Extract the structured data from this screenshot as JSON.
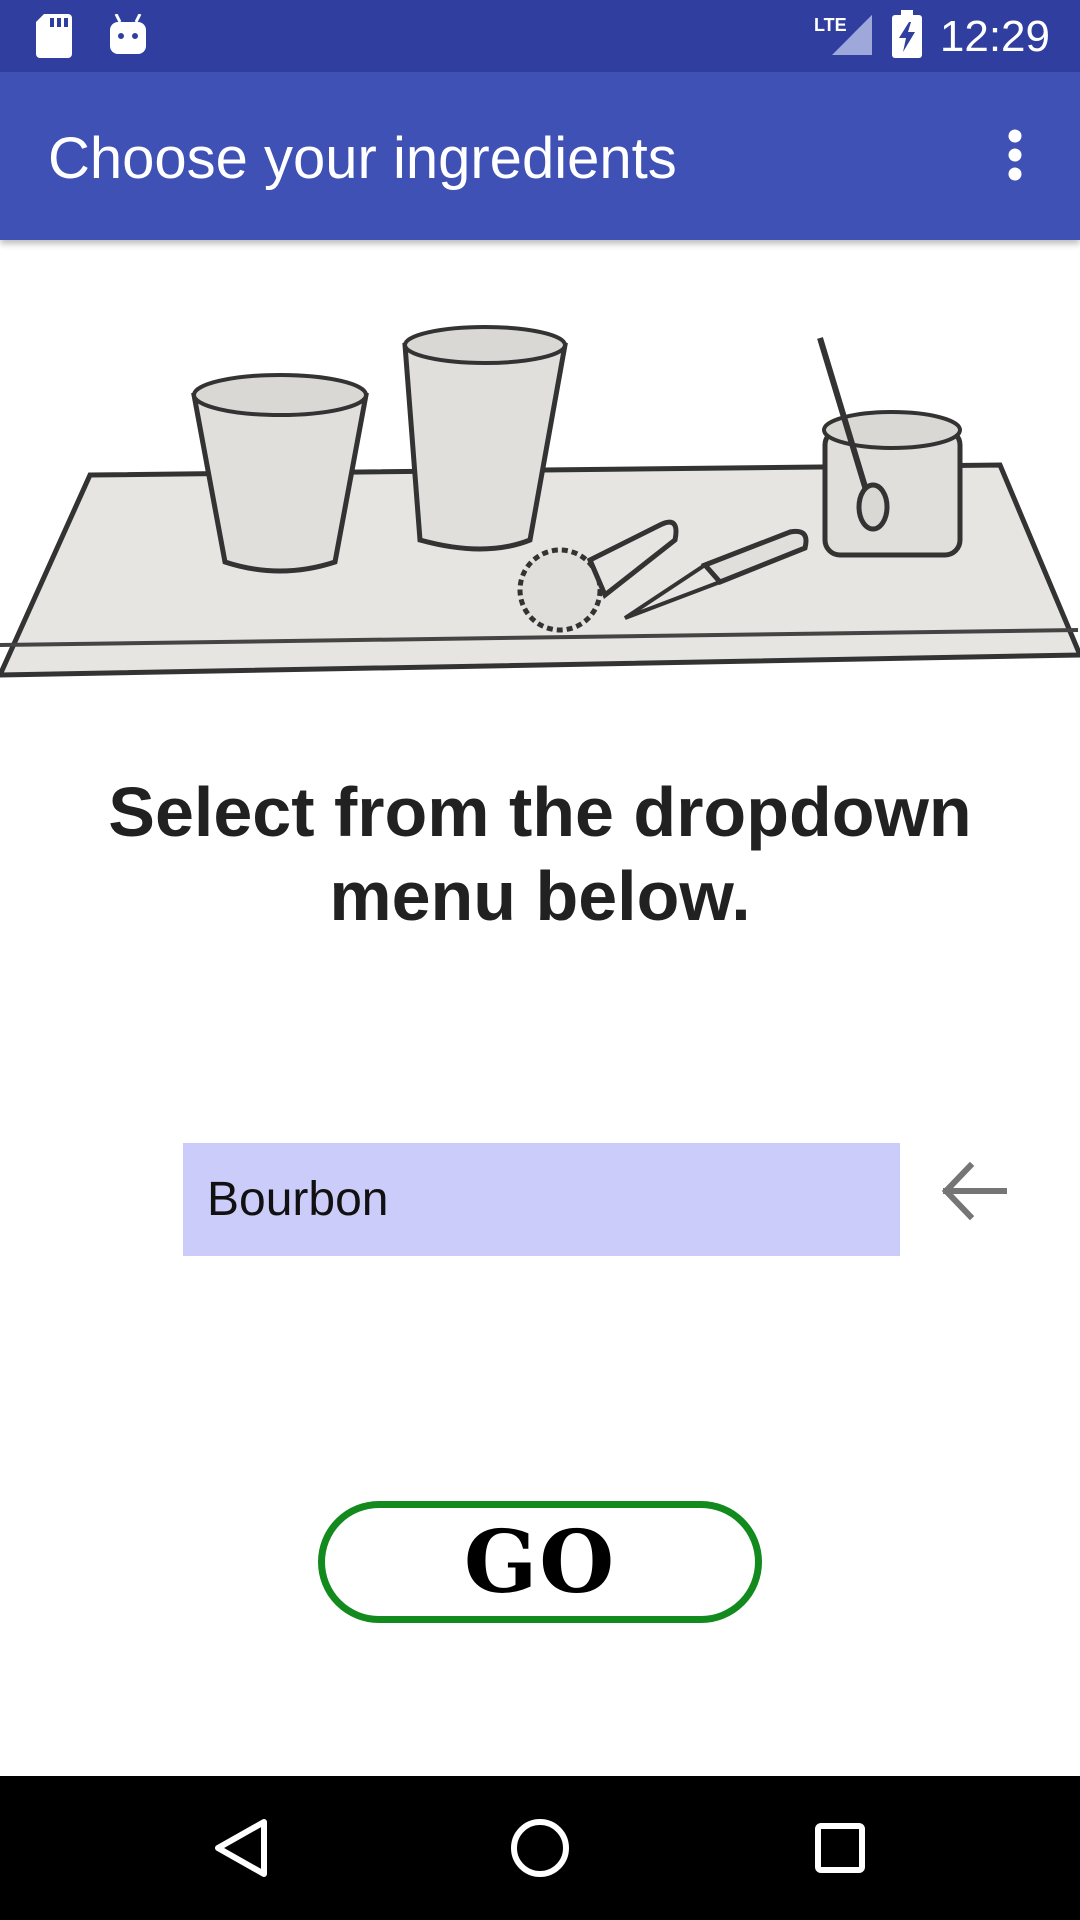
{
  "status_bar": {
    "time": "12:29",
    "network": "LTE",
    "icons": [
      "sd-card-icon",
      "android-icon",
      "lte-signal-icon",
      "battery-charging-icon"
    ],
    "background": "#303f9f"
  },
  "app_bar": {
    "title": "Choose your ingredients",
    "menu_icon": "more-vertical-icon",
    "background": "#3f51b5"
  },
  "main": {
    "illustration": "bar-tools-sketch",
    "instruction": "Select from the dropdown menu below.",
    "spinner": {
      "selected_value": "Bourbon",
      "background": "#ccccfb"
    },
    "back_icon": "arrow-left-icon",
    "go_button": {
      "label": "GO",
      "border_color": "#138a1e"
    }
  },
  "nav_bar": {
    "buttons": [
      "back-triangle-icon",
      "home-circle-icon",
      "recents-square-icon"
    ]
  }
}
